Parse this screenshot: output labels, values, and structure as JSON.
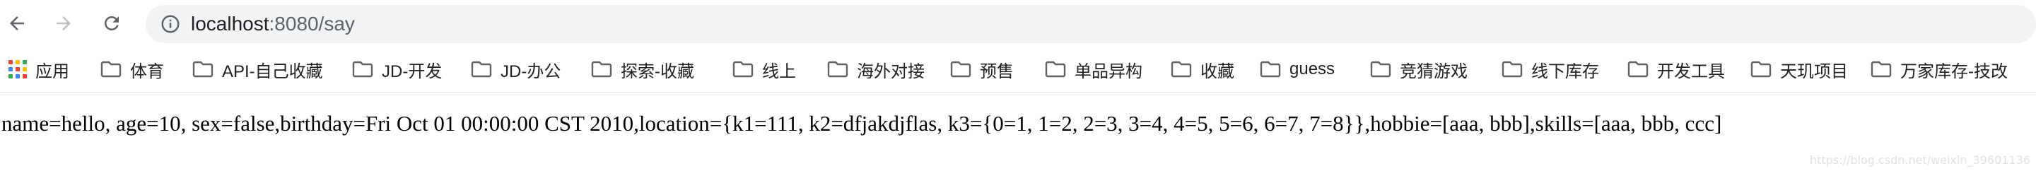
{
  "toolbar": {
    "url_host": "localhost",
    "url_rest": ":8080/say"
  },
  "bookmarks": {
    "apps_label": "应用",
    "apps_colors": [
      "#ea4335",
      "#fbbc05",
      "#34a853",
      "#4285f4",
      "#ea4335",
      "#fbbc05",
      "#34a853",
      "#4285f4",
      "#ea4335"
    ],
    "items": [
      "体育",
      "API-自己收藏",
      "JD-开发",
      "JD-办公",
      "探索-收藏",
      "线上",
      "海外对接",
      "预售",
      "单品异构",
      "收藏",
      "guess",
      "竞猜游戏",
      "线下库存",
      "开发工具",
      "天玑项目",
      "万家库存-技改"
    ]
  },
  "content": {
    "text": "name=hello, age=10, sex=false,birthday=Fri Oct 01 00:00:00 CST 2010,location={k1=111, k2=dfjakdjflas, k3={0=1, 1=2, 2=3, 3=4, 4=5, 5=6, 6=7, 7=8}},hobbie=[aaa, bbb],skills=[aaa, bbb, ccc]"
  },
  "watermark": {
    "text": "https://blog.csdn.net/weixin_39601136"
  }
}
